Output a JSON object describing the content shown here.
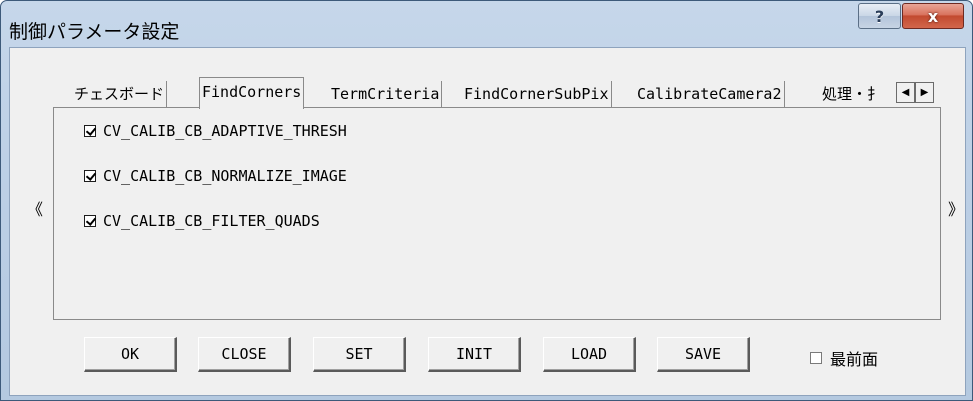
{
  "window": {
    "title": "制御パラメータ設定",
    "help_label": "?",
    "close_label": "x"
  },
  "nav": {
    "prev": "《",
    "next": "》"
  },
  "tabs": [
    {
      "label": "チェスボード",
      "active": false
    },
    {
      "label": "FindCorners",
      "active": true
    },
    {
      "label": "TermCriteria",
      "active": false
    },
    {
      "label": "FindCornerSubPix",
      "active": false
    },
    {
      "label": "CalibrateCamera2",
      "active": false
    },
    {
      "label": "処理・扌",
      "active": false
    }
  ],
  "tab_scroll": {
    "left": "◀",
    "right": "▶"
  },
  "panel": {
    "options": [
      {
        "label": "CV_CALIB_CB_ADAPTIVE_THRESH",
        "checked": true
      },
      {
        "label": "CV_CALIB_CB_NORMALIZE_IMAGE",
        "checked": true
      },
      {
        "label": "CV_CALIB_CB_FILTER_QUADS",
        "checked": true
      }
    ]
  },
  "buttons": {
    "ok": "OK",
    "close": "CLOSE",
    "set": "SET",
    "init": "INIT",
    "load": "LOAD",
    "save": "SAVE"
  },
  "topmost": {
    "label": "最前面",
    "checked": false
  },
  "colors": {
    "title_bar": "#bdd0e6",
    "client_bg": "#f0f0f0",
    "close_button": "#c24a30"
  }
}
